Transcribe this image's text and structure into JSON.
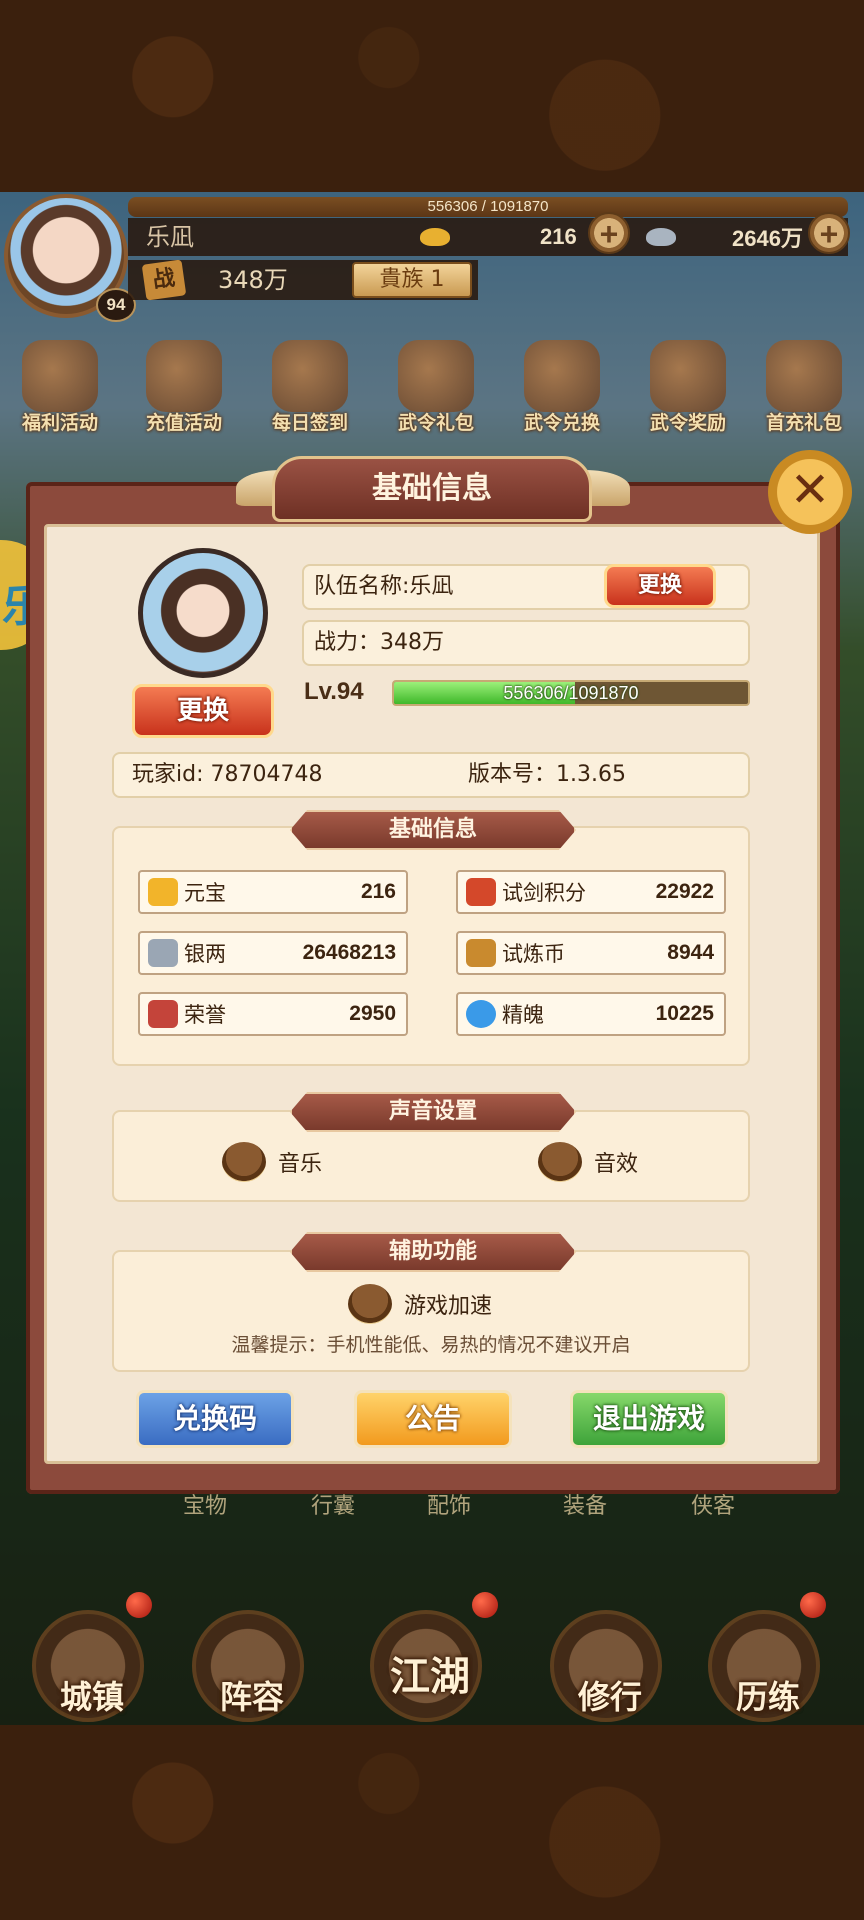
{
  "hud": {
    "exp_text": "556306 / 1091870",
    "player_name": "乐凪",
    "level": "94",
    "gold": "216",
    "silver": "2646万",
    "plus": "+",
    "power_icon": "战",
    "power": "348万",
    "noble": "貴族 1"
  },
  "activities": [
    {
      "label": "福利活动"
    },
    {
      "label": "充值活动"
    },
    {
      "label": "每日签到"
    },
    {
      "label": "武令礼包"
    },
    {
      "label": "武令兑换"
    },
    {
      "label": "武令奖励"
    },
    {
      "label": "首充礼包"
    }
  ],
  "side_badge": "乐",
  "bottom_tabs": [
    "宝物",
    "行囊",
    "配饰",
    "装备",
    "侠客"
  ],
  "nav": [
    {
      "label": "城镇"
    },
    {
      "label": "阵容"
    },
    {
      "label": "江湖"
    },
    {
      "label": "修行"
    },
    {
      "label": "历练"
    }
  ],
  "dialog": {
    "title": "基础信息",
    "close": "✕",
    "change_avatar": "更换",
    "team_name": "队伍名称:乐凪",
    "change_name": "更换",
    "power": "战力：348万",
    "level": "Lv.94",
    "exp": "556306/1091870",
    "exp_progress": 0.51,
    "player_id": "玩家id: 78704748",
    "version": "版本号：1.3.65",
    "stats_title": "基础信息",
    "stats": [
      {
        "name": "元宝",
        "value": "216",
        "icon": "gold-ingot-icon",
        "color": "#f2b42a"
      },
      {
        "name": "试剑积分",
        "value": "22922",
        "icon": "sword-points-icon",
        "color": "#d4482a"
      },
      {
        "name": "银两",
        "value": "26468213",
        "icon": "silver-ingot-icon",
        "color": "#9aa6b4"
      },
      {
        "name": "试炼币",
        "value": "8944",
        "icon": "trial-coin-icon",
        "color": "#c98a2e"
      },
      {
        "name": "荣誉",
        "value": "2950",
        "icon": "honor-icon",
        "color": "#c4443a"
      },
      {
        "name": "精魄",
        "value": "10225",
        "icon": "spirit-icon",
        "color": "#3a9ae8"
      }
    ],
    "sound_title": "声音设置",
    "music": "音乐",
    "sfx": "音效",
    "assist_title": "辅助功能",
    "speedup": "游戏加速",
    "hint": "温馨提示：手机性能低、易热的情况不建议开启",
    "redeem": "兑换码",
    "notice": "公告",
    "logout": "退出游戏"
  }
}
